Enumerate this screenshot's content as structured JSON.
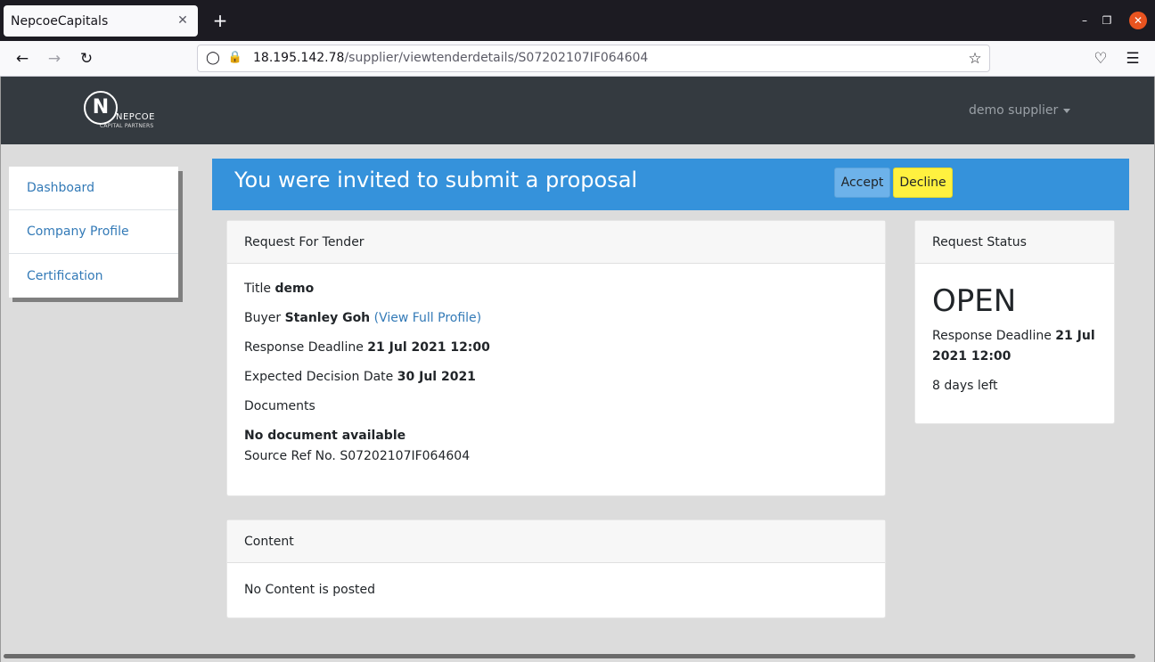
{
  "browser": {
    "tab_title": "NepcoeCapitals",
    "tab_close": "✕",
    "new_tab": "+",
    "url_host": "18.195.142.78",
    "url_path": "/supplier/viewtenderdetails/S07202107IF064604"
  },
  "header": {
    "logo_mark": "N",
    "logo_name": "NEPCOE",
    "logo_sub": "CAPITAL PARTNERS",
    "user_name": "demo supplier"
  },
  "sidebar": {
    "items": [
      {
        "label": "Dashboard"
      },
      {
        "label": "Company Profile"
      },
      {
        "label": "Certification"
      }
    ]
  },
  "alert": {
    "message": "You were invited to submit a proposal",
    "accept_label": "Accept",
    "decline_label": "Decline"
  },
  "rft": {
    "header": "Request For Tender",
    "title_label": "Title",
    "title_value": "demo",
    "buyer_label": "Buyer",
    "buyer_value": "Stanley Goh",
    "buyer_link": "(View Full Profile)",
    "deadline_label": "Response Deadline",
    "deadline_value": "21 Jul 2021 12:00",
    "decision_label": "Expected Decision Date",
    "decision_value": "30 Jul 2021",
    "documents_label": "Documents",
    "no_documents": "No document available",
    "source_ref_label": "Source Ref No.",
    "source_ref_value": "S07202107IF064604"
  },
  "status": {
    "header": "Request Status",
    "state": "OPEN",
    "deadline_label": "Response Deadline",
    "deadline_value": "21 Jul 2021 12:00",
    "days_left": "8 days left"
  },
  "content": {
    "header": "Content",
    "body": "No Content is posted"
  }
}
